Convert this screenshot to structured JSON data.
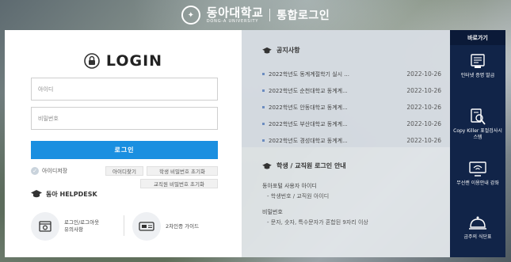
{
  "header": {
    "university_name": "동아대학교",
    "university_name_en": "DONG-A UNIVERSITY",
    "portal_title": "통합로그인"
  },
  "login": {
    "title": "LOGIN",
    "id_placeholder": "아이디",
    "pw_placeholder": "비밀번호",
    "login_button": "로그인",
    "save_id_label": "아이디저장",
    "find_id_button": "아이디찾기",
    "reset_student_pw_button": "학생 비밀번호 초기화",
    "reset_staff_pw_button": "교직원 비밀번호 초기화"
  },
  "helpdesk": {
    "title": "동아 HELPDESK",
    "items": [
      {
        "label": "로그인/로그아웃 유의사항",
        "icon": "login-notice-icon"
      },
      {
        "label": "2차인증 가이드",
        "icon": "two-factor-icon"
      }
    ]
  },
  "notices": {
    "title": "공지사항",
    "items": [
      {
        "title": "2022학년도 동계계절학기 실시 ...",
        "date": "2022-10-26"
      },
      {
        "title": "2022학년도 순천대학교 동계계...",
        "date": "2022-10-26"
      },
      {
        "title": "2022학년도 안동대학교 동계계...",
        "date": "2022-10-26"
      },
      {
        "title": "2022학년도 부산대학교 동계계...",
        "date": "2022-10-26"
      },
      {
        "title": "2022학년도 경성대학교 동계계...",
        "date": "2022-10-26"
      }
    ]
  },
  "guide": {
    "title": "학생 / 교직원 로그인 안내",
    "items": [
      {
        "text": "동아포털 사용자 아이디",
        "level": 0
      },
      {
        "text": "- 학생번호 / 교직원 아이디",
        "level": 1
      },
      {
        "text": "비밀번호",
        "level": 0
      },
      {
        "text": "- 문자, 숫자, 특수문자가 혼합된 9자리 이상",
        "level": 1
      }
    ]
  },
  "quick_menu": {
    "title": "바로가기",
    "items": [
      {
        "label": "인터넷 증명 발급",
        "icon": "certificate-icon"
      },
      {
        "label": "Copy Killer 표절검사시스템",
        "icon": "plagiarism-check-icon"
      },
      {
        "label": "무선랜 이용안내 강좌",
        "icon": "wireless-lan-icon"
      },
      {
        "label": "금주의 식단표",
        "icon": "meal-menu-icon"
      }
    ]
  },
  "colors": {
    "login_button": "#1a8fe0",
    "quick_menu_bg": "#112448"
  }
}
